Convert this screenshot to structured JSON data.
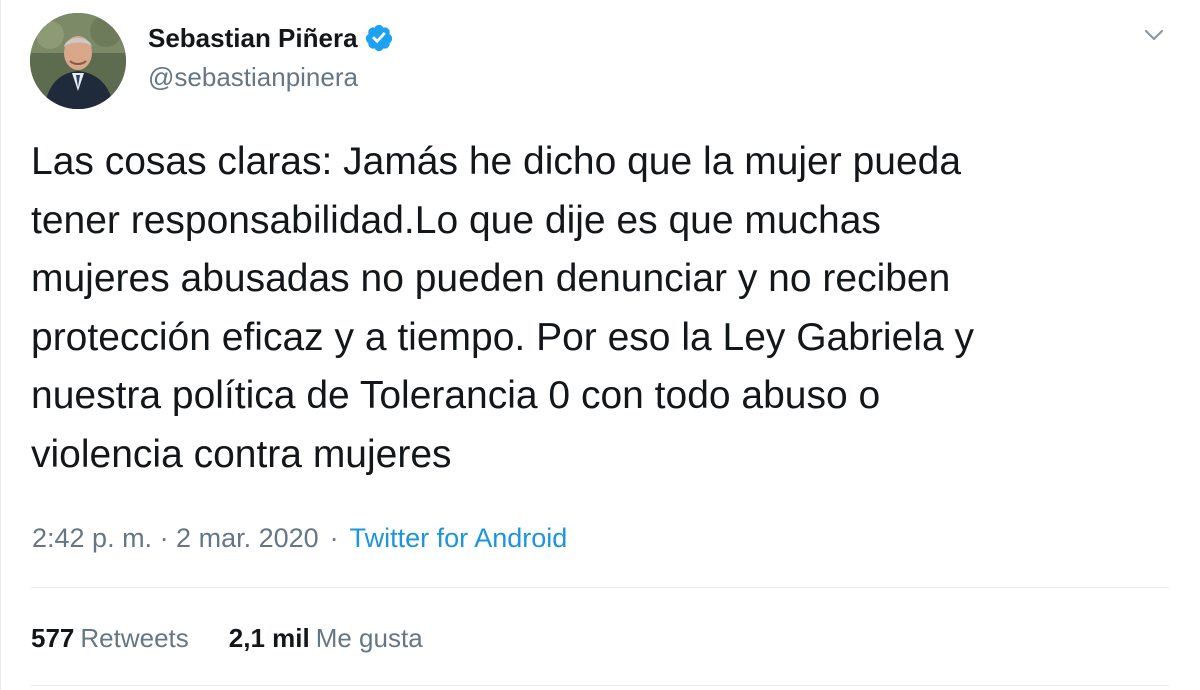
{
  "author": {
    "display_name": "Sebastian Piñera",
    "handle": "@sebastianpinera",
    "verified": true,
    "avatar_icon": "avatar-photo"
  },
  "tweet": {
    "text_lines": [
      "Las cosas claras: Jamás he dicho que la mujer pueda",
      "tener responsabilidad.Lo que dije es que muchas",
      "mujeres abusadas no pueden denunciar y no reciben",
      "protección eficaz y a tiempo. Por eso la Ley Gabriela y",
      "nuestra política de Tolerancia 0 con todo abuso o",
      "violencia contra mujeres"
    ],
    "time": "2:42 p. m. · 2 mar. 2020",
    "separator": "·",
    "source": "Twitter for Android"
  },
  "stats": {
    "retweets_count": "577",
    "retweets_label": "Retweets",
    "likes_count": "2,1 mil",
    "likes_label": "Me gusta"
  },
  "icons": {
    "verified": "verified-badge-icon",
    "menu": "chevron-down-icon"
  },
  "colors": {
    "text": "#14171a",
    "secondary": "#657786",
    "link": "#1b95e0",
    "verified": "#1da1f2",
    "divider": "#e6ecf0"
  }
}
